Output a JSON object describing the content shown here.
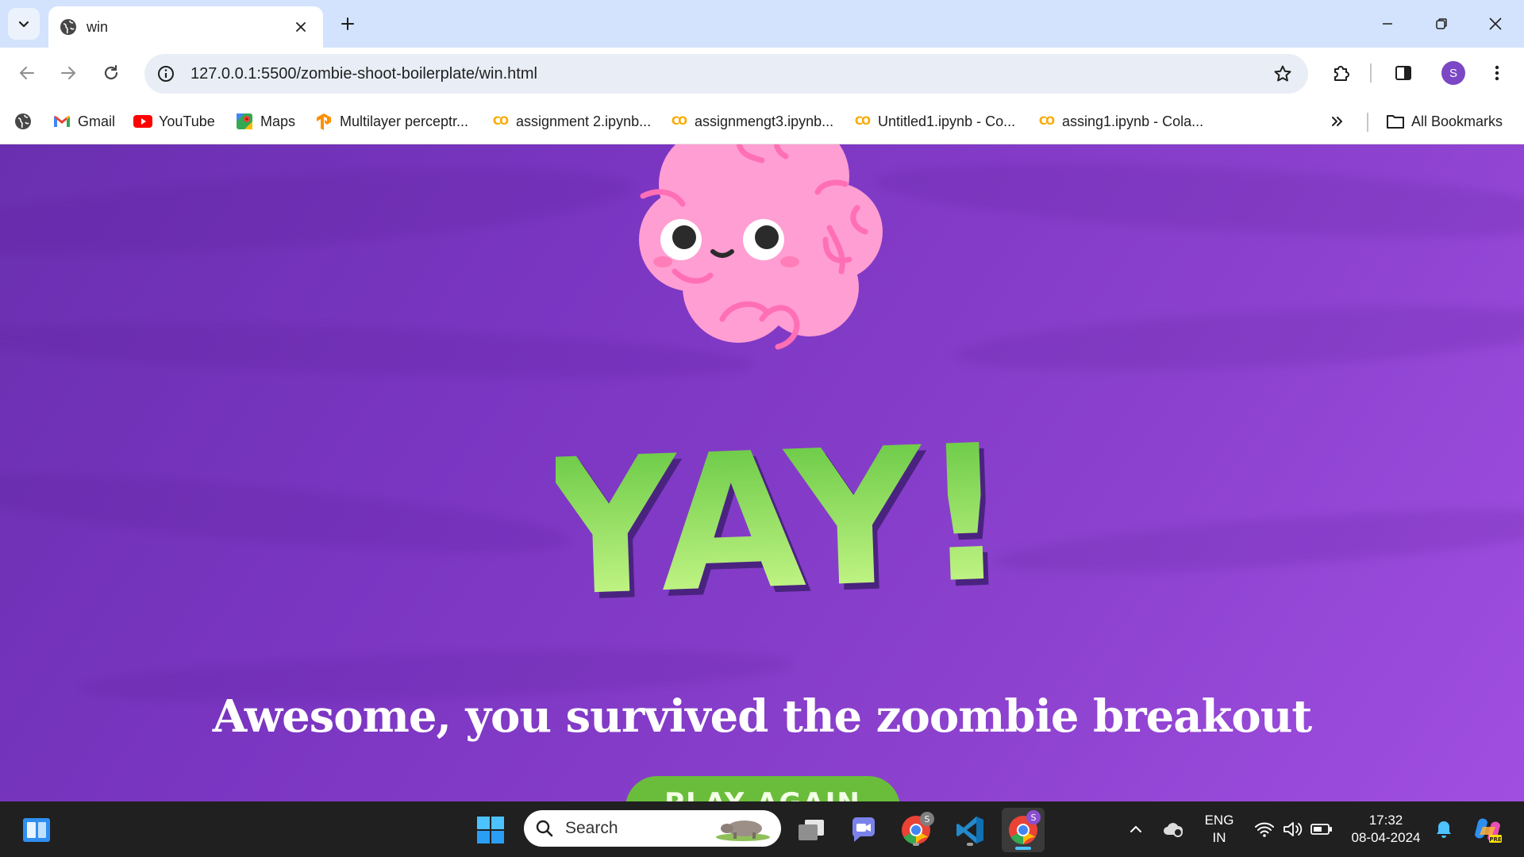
{
  "browser": {
    "tab": {
      "title": "win"
    },
    "url": "127.0.0.1:5500/zombie-shoot-boilerplate/win.html",
    "profile_initial": "S",
    "bookmarks": [
      {
        "label": "Gmail",
        "icon": "gmail-icon"
      },
      {
        "label": "YouTube",
        "icon": "youtube-icon"
      },
      {
        "label": "Maps",
        "icon": "maps-icon"
      },
      {
        "label": "Multilayer perceptr...",
        "icon": "tensorflow-icon"
      },
      {
        "label": "assignment 2.ipynb...",
        "icon": "colab-icon"
      },
      {
        "label": "assignmengt3.ipynb...",
        "icon": "colab-icon"
      },
      {
        "label": "Untitled1.ipynb - Co...",
        "icon": "colab-icon"
      },
      {
        "label": "assing1.ipynb - Cola...",
        "icon": "colab-icon"
      }
    ],
    "all_bookmarks_label": "All Bookmarks"
  },
  "page": {
    "yay_text": "YAY!",
    "headline": "Awesome, you survived the zoombie breakout",
    "play_again_label": "PLAY AGAIN"
  },
  "taskbar": {
    "search_label": "Search",
    "language_line1": "ENG",
    "language_line2": "IN",
    "time": "17:32",
    "date": "08-04-2024"
  },
  "colors": {
    "page_purple": "#8a3fc7",
    "brain_pink": "#ff9ed2",
    "yay_green": "#8ee04a",
    "button_green": "#6abd3a",
    "tab_strip": "#d3e3fd"
  }
}
